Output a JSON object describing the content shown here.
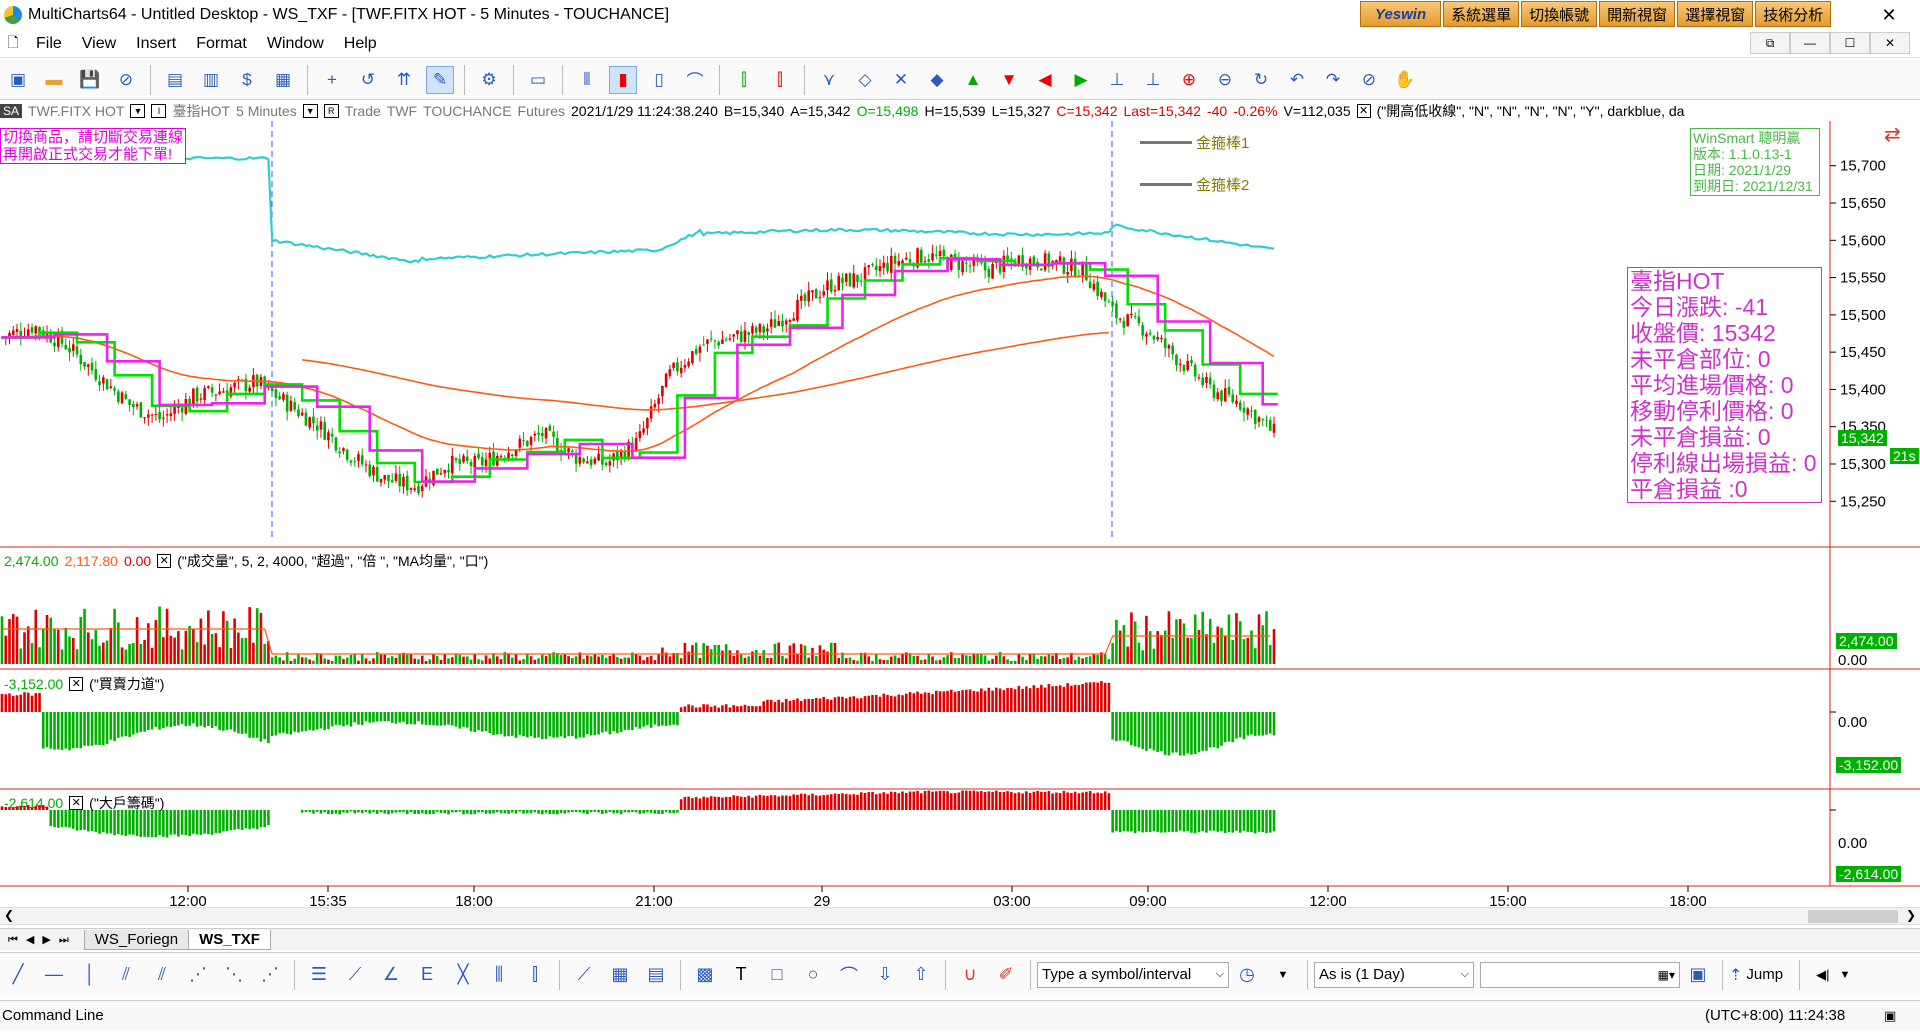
{
  "window": {
    "title": "MultiCharts64 - Untitled Desktop - WS_TXF - [TWF.FITX HOT - 5 Minutes - TOUCHANCE]",
    "close": "✕",
    "minimize": "—",
    "maximize": "☐"
  },
  "yeswin": {
    "logo": "Yeswin",
    "buttons": [
      "系統選單",
      "切換帳號",
      "開新視窗",
      "選擇視窗",
      "技術分析"
    ]
  },
  "menu": [
    "File",
    "View",
    "Insert",
    "Format",
    "Window",
    "Help"
  ],
  "status": {
    "sa": "SA",
    "symbol": "TWF.FITX HOT",
    "name": "臺指HOT",
    "interval": "5 Minutes",
    "r": "R",
    "trade": "Trade",
    "exchange": "TWF",
    "feed": "TOUCHANCE",
    "category": "Futures",
    "datetime": "2021/1/29  11:24:38.240",
    "bid": "B=15,340",
    "ask": "A=15,342",
    "open": "O=15,498",
    "high": "H=15,539",
    "low": "L=15,327",
    "close": "C=15,342",
    "last": "Last=15,342",
    "change": "-40",
    "pct": "-0.26%",
    "volume": "V=112,035",
    "study": "(\"開高低收線\", \"N\", \"N\", \"N\", \"N\", \"Y\", darkblue, da"
  },
  "warning": [
    "切換商品，請切斷交易連線",
    "再開啟正式交易才能下單!"
  ],
  "winsmart": [
    "WinSmart 聰明贏",
    "版本: 1.1.0.13-1",
    "日期: 2021/1/29",
    "到期日: 2021/12/31"
  ],
  "legend": {
    "line1": "金箍棒1",
    "line2": "金箍棒2"
  },
  "info": [
    "臺指HOT",
    "今日漲跌: -41",
    "收盤價: 15342",
    "未平倉部位: 0",
    "平均進場價格: 0",
    "移動停利價格: 0",
    "未平倉損益: 0",
    "停利線出場損益: 0",
    "平倉損益 :0"
  ],
  "panes": {
    "vol": {
      "v1": "2,474.00",
      "v2": "2,117.80",
      "v3": "0.00",
      "params": "(\"成交量\", 5, 2, 4000, \"超過\", \"倍 \", \"MA均量\", \"口\")",
      "tag": "2,474.00",
      "zero": "0.00"
    },
    "buysell": {
      "v1": "-3,152.00",
      "params": "(\"買賣力道\")",
      "tag": "-3,152.00",
      "zero": "0.00"
    },
    "big": {
      "v1": "-2,614.00",
      "params": "(\"大戶籌碼\")",
      "tag": "-2,614.00",
      "zero": "0.00"
    }
  },
  "price": {
    "tag": "15,342",
    "countdown": "21s"
  },
  "tabs": [
    "WS_Foriegn",
    "WS_TXF"
  ],
  "drawbar": {
    "symbol_placeholder": "Type a symbol/interval",
    "resolution": "As is (1 Day)",
    "jump": "Jump"
  },
  "statusbar": {
    "left": "Command Line",
    "time": "(UTC+8:00) 11:24:38"
  },
  "chart_data": {
    "type": "line",
    "title": "TWF.FITX HOT - 5 Minutes",
    "y_ticks": [
      15700,
      15650,
      15600,
      15550,
      15500,
      15450,
      15400,
      15350,
      15300,
      15250
    ],
    "ylim": [
      15190,
      15760
    ],
    "x_ticks": [
      "12:00",
      "15:35",
      "18:00",
      "21:00",
      "29",
      "03:00",
      "09:00",
      "12:00",
      "15:00",
      "18:00"
    ],
    "candles_close_sampled": [
      15470,
      15485,
      15460,
      15420,
      15380,
      15360,
      15390,
      15400,
      15410,
      15380,
      15350,
      15310,
      15280,
      15270,
      15300,
      15300,
      15320,
      15340,
      15310,
      15300,
      15330,
      15420,
      15460,
      15470,
      15480,
      15510,
      15540,
      15550,
      15570,
      15580,
      15570,
      15560,
      15575,
      15570,
      15560,
      15500,
      15480,
      15440,
      15400,
      15380,
      15342
    ],
    "series": [
      {
        "name": "金箍棒1",
        "color": "#00e000"
      },
      {
        "name": "金箍棒2",
        "color": "#ee22ee"
      }
    ]
  },
  "colors": {
    "up": "#e00000",
    "down": "#00b000",
    "cyan": "#33cccc",
    "orange": "#ff5a14",
    "magenta": "#ee22ee",
    "green": "#00e000"
  }
}
